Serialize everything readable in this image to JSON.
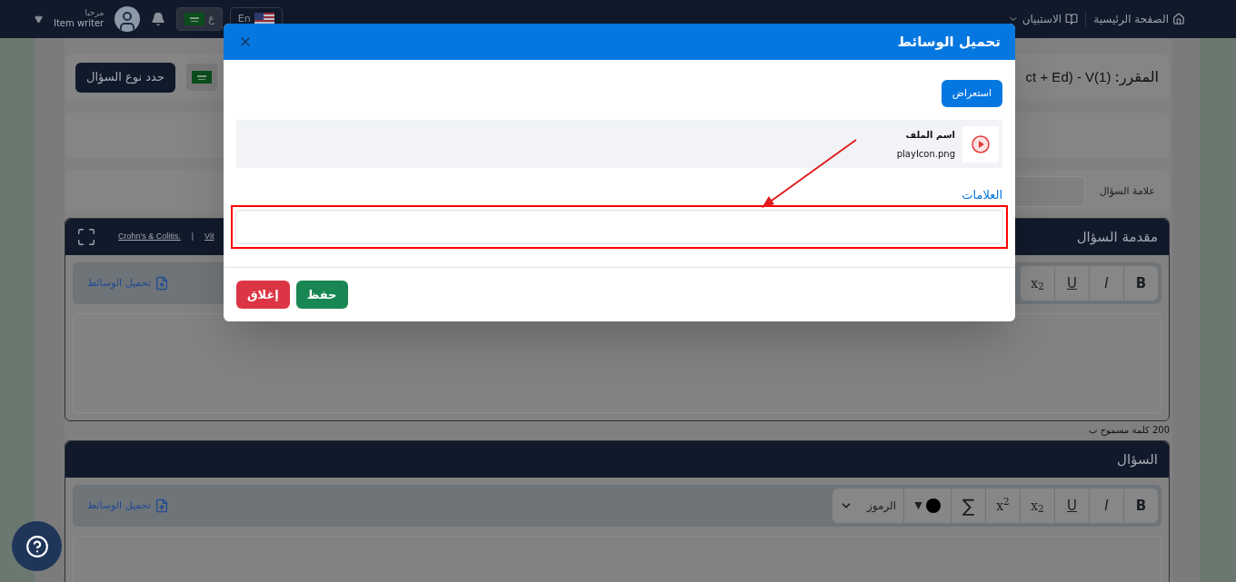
{
  "navbar": {
    "nav_items": [
      {
        "label": "الصفحة الرئيسية",
        "kind": "home"
      },
      {
        "label": "الاستبيان",
        "kind": "menu"
      }
    ],
    "languages": [
      {
        "label": "En",
        "kind": "us"
      },
      {
        "label": "ع",
        "kind": "sa"
      }
    ],
    "user": {
      "greeting": "مرحبا",
      "name": "Item writer"
    }
  },
  "page": {
    "course": {
      "label": "المقرر:",
      "value": "ct + Ed) - V(1)"
    },
    "select_type_button": "حدد نوع السؤال",
    "mark_label": "علامة السؤال",
    "sections": [
      {
        "title": "مقدمة السؤال",
        "links": [
          "Vit",
          "|",
          "Crohn's & Colitis."
        ],
        "upload": "تحميل الوسائط",
        "footnote": "200 كلمة مسموح ب",
        "toolbar": [
          {
            "kind": "bold",
            "label": "B"
          },
          {
            "kind": "italic",
            "label": "I"
          },
          {
            "kind": "underline",
            "label": "U"
          },
          {
            "kind": "script",
            "label": "x$_{2}$"
          }
        ]
      },
      {
        "title": "السؤال",
        "upload": "تحميل الوسائط",
        "toolbar": [
          {
            "kind": "bold",
            "label": "B"
          },
          {
            "kind": "italic",
            "label": "I"
          },
          {
            "kind": "underline",
            "label": "U"
          },
          {
            "kind": "script",
            "label": "x$_{2}$"
          },
          {
            "kind": "script",
            "label": "x$^{2}$"
          },
          {
            "kind": "sum",
            "label": "∑"
          },
          {
            "kind": "color",
            "label": "▼",
            "color": "#000000"
          },
          {
            "kind": "symbols",
            "label": "الرموز"
          }
        ]
      }
    ]
  },
  "modal": {
    "title": "تحميل الوسائط",
    "browse_button": "استعراض",
    "file": {
      "name_label": "اسم الملف",
      "filename": "playIcon.png"
    },
    "tags_label": "العلامات",
    "buttons": [
      {
        "label": "حفظ",
        "kind": "primary"
      },
      {
        "label": "إغلاق",
        "kind": "danger"
      }
    ]
  }
}
